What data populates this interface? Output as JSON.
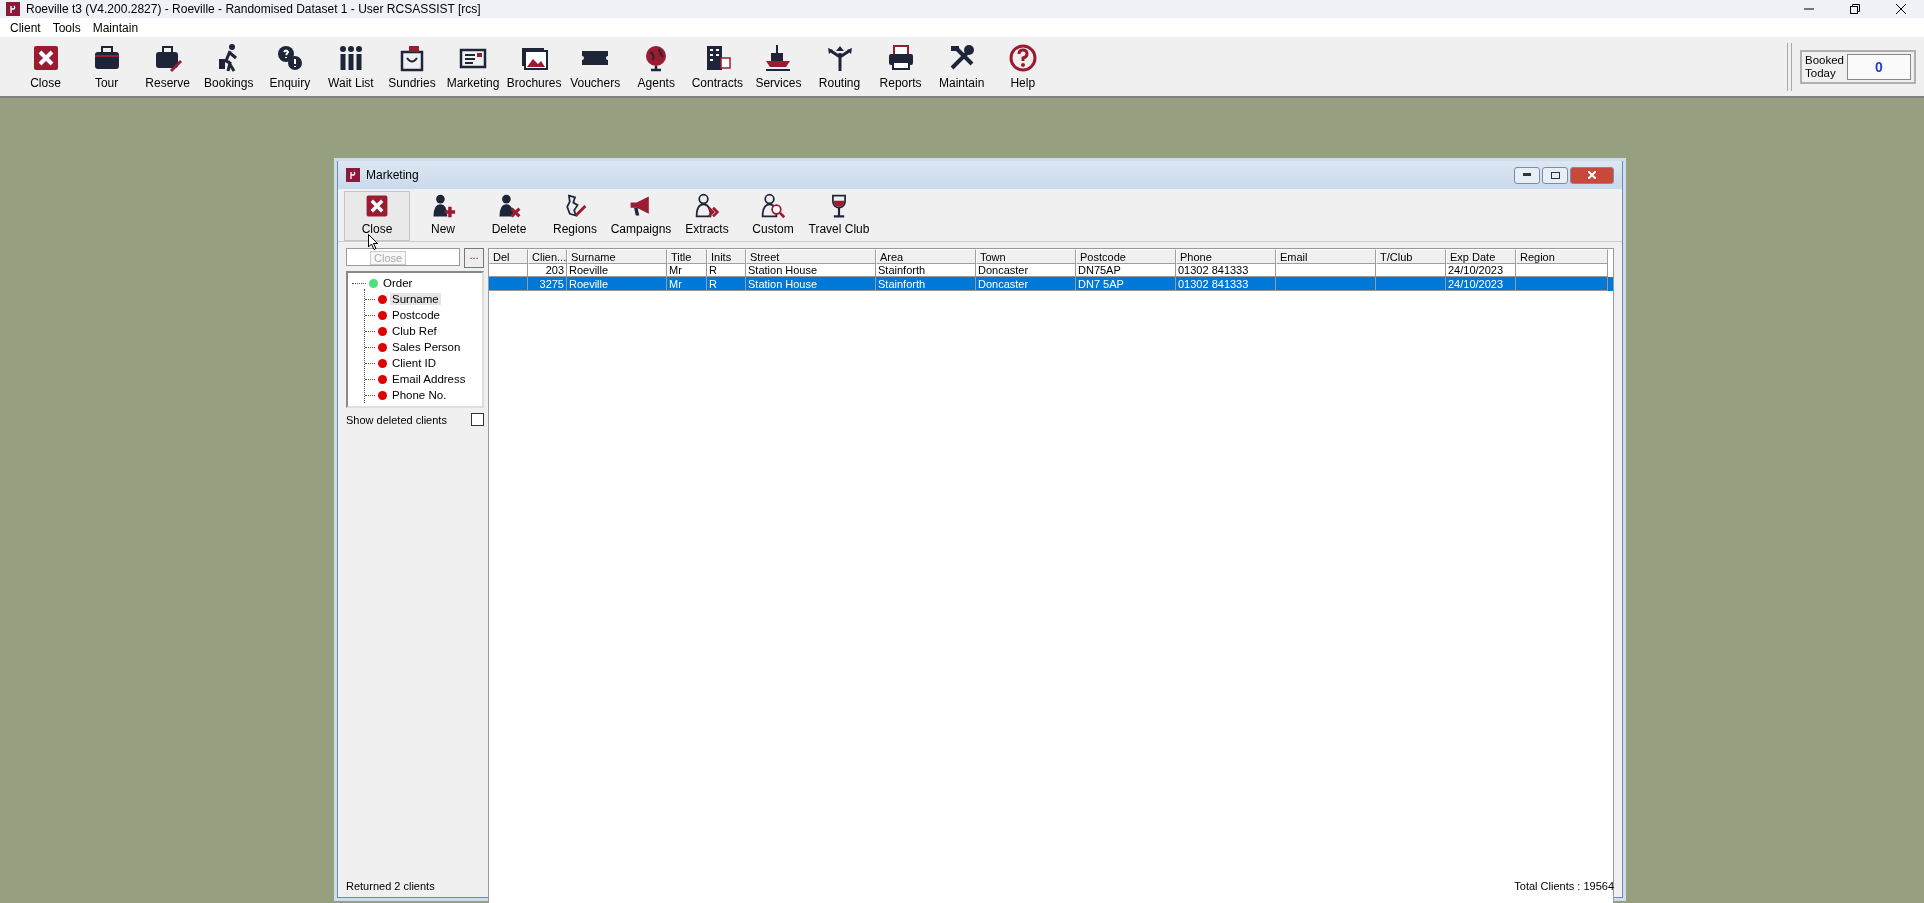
{
  "app": {
    "title": "Roeville t3 (V4.200.2827) - Roeville - Randomised Dataset 1 - User RCSASSIST [rcs]"
  },
  "menu": [
    "Client",
    "Tools",
    "Maintain"
  ],
  "toolbar": [
    "Close",
    "Tour",
    "Reserve",
    "Bookings",
    "Enquiry",
    "Wait List",
    "Sundries",
    "Marketing",
    "Brochures",
    "Vouchers",
    "Agents",
    "Contracts",
    "Services",
    "Routing",
    "Reports",
    "Maintain",
    "Help"
  ],
  "booked_today": {
    "label": "Booked Today",
    "value": "0"
  },
  "window": {
    "title": "Marketing",
    "toolbar": [
      {
        "label": "Close",
        "selected": true
      },
      {
        "label": "New",
        "selected": false
      },
      {
        "label": "Delete",
        "selected": false
      },
      {
        "label": "Regions",
        "selected": false
      },
      {
        "label": "Campaigns",
        "selected": false
      },
      {
        "label": "Extracts",
        "selected": false
      },
      {
        "label": "Custom",
        "selected": false
      },
      {
        "label": "Travel Club",
        "selected": false
      }
    ],
    "tooltip": "Close",
    "search": {
      "button": "..."
    },
    "tree": [
      {
        "label": "Order",
        "color": "#4fe07a",
        "selected": false,
        "children": [
          {
            "label": "Surname",
            "color": "#e00000",
            "selected": true
          },
          {
            "label": "Postcode",
            "color": "#e00000",
            "selected": false
          },
          {
            "label": "Club Ref",
            "color": "#e00000",
            "selected": false
          },
          {
            "label": "Sales Person",
            "color": "#e00000",
            "selected": false
          },
          {
            "label": "Client ID",
            "color": "#e00000",
            "selected": false
          },
          {
            "label": "Email Address",
            "color": "#e00000",
            "selected": false
          },
          {
            "label": "Phone No.",
            "color": "#e00000",
            "selected": false
          }
        ]
      }
    ],
    "show_deleted": {
      "label": "Show deleted clients",
      "checked": false
    },
    "table": {
      "columns": [
        "Del",
        "Clien...",
        "Surname",
        "Title",
        "Inits",
        "Street",
        "Area",
        "Town",
        "Postcode",
        "Phone",
        "Email",
        "T/Club",
        "Exp Date",
        "Region"
      ],
      "rows": [
        {
          "selected": false,
          "cells": [
            "",
            "203",
            "Roeville",
            "Mr",
            "R",
            "Station House",
            "Stainforth",
            "Doncaster",
            "DN75AP",
            "01302 841333",
            "",
            "",
            "24/10/2023",
            ""
          ]
        },
        {
          "selected": true,
          "cells": [
            "",
            "3275",
            "Roeville",
            "Mr",
            "R",
            "Station House",
            "Stainforth",
            "Doncaster",
            "DN7 5AP",
            "01302 841333",
            "",
            "",
            "24/10/2023",
            ""
          ]
        }
      ]
    },
    "status_left": "Returned 2 clients",
    "status_right": "Total Clients : 19564"
  }
}
